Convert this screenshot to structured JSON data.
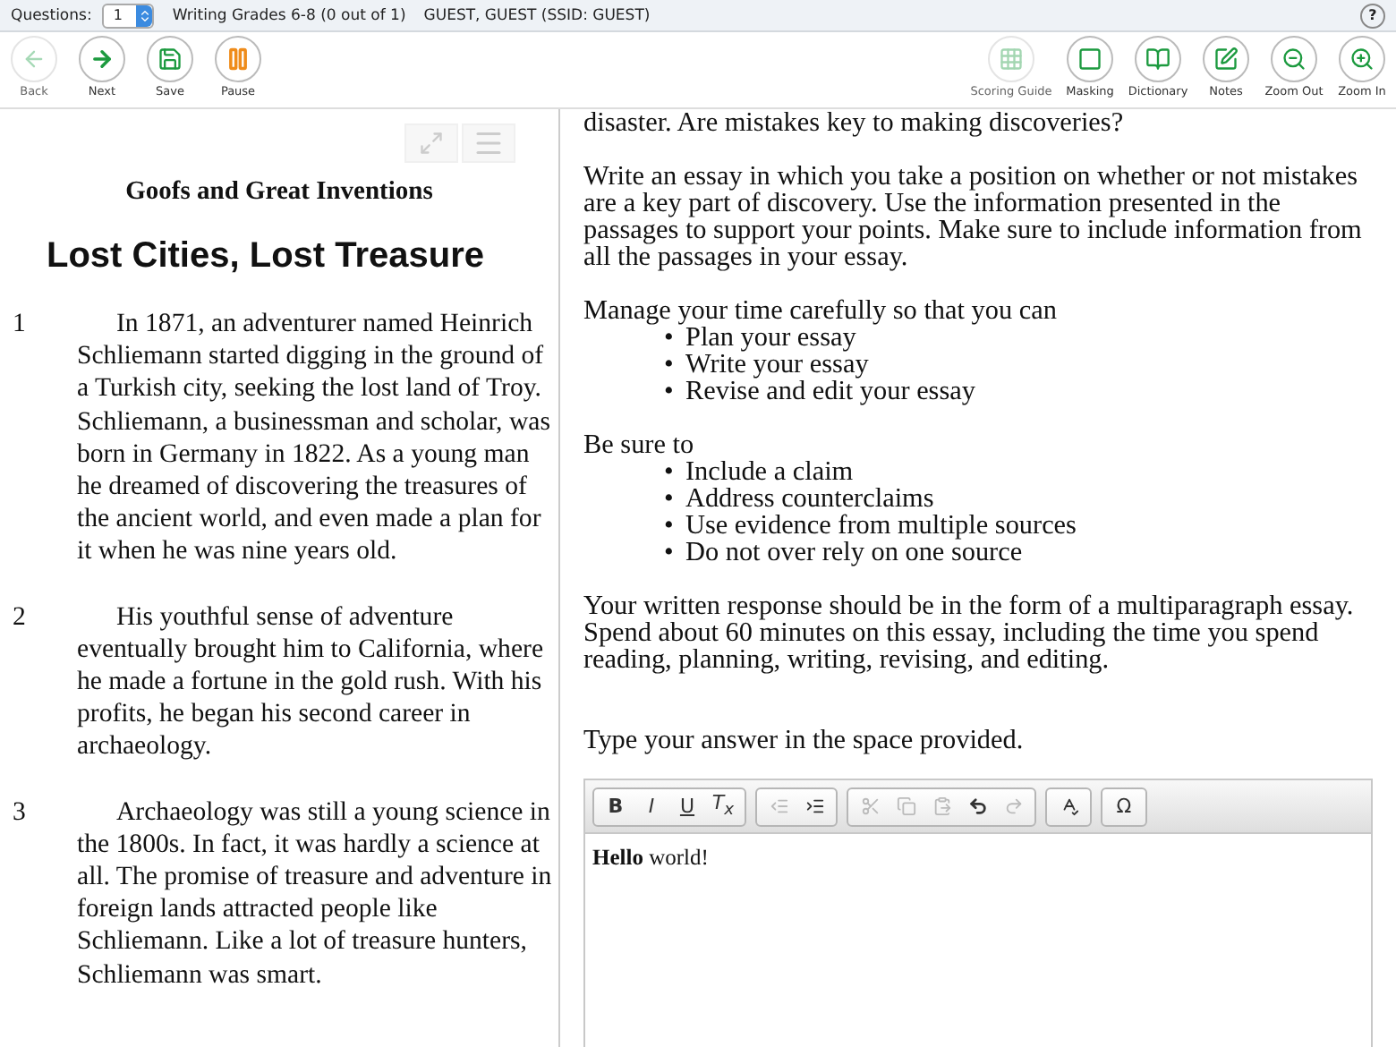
{
  "top_bar": {
    "questions_label": "Questions:",
    "question_value": "1",
    "test_title": "Writing Grades 6-8 (0 out of 1)",
    "student": "GUEST, GUEST (SSID: GUEST)",
    "help": "?"
  },
  "nav_buttons": [
    {
      "kind": "back",
      "label": "Back",
      "disabled": true
    },
    {
      "kind": "next",
      "label": "Next",
      "disabled": false
    },
    {
      "kind": "save",
      "label": "Save",
      "disabled": false
    },
    {
      "kind": "pause",
      "label": "Pause",
      "disabled": false
    }
  ],
  "tool_buttons": [
    {
      "kind": "scoring",
      "label": "Scoring Guide",
      "disabled": true
    },
    {
      "kind": "masking",
      "label": "Masking",
      "disabled": false
    },
    {
      "kind": "dictionary",
      "label": "Dictionary",
      "disabled": false
    },
    {
      "kind": "notes",
      "label": "Notes",
      "disabled": false
    },
    {
      "kind": "zoom_out",
      "label": "Zoom Out",
      "disabled": false
    },
    {
      "kind": "zoom_in",
      "label": "Zoom In",
      "disabled": false
    }
  ],
  "passage": {
    "subtitle": "Goofs and Great Inventions",
    "title": "Lost Cities, Lost Treasure",
    "paragraphs": [
      {
        "number": "1",
        "text": "In 1871, an adventurer named Heinrich Schliemann started digging in the ground of a Turkish city, seeking the lost land of Troy. Schliemann, a businessman and scholar, was born in Germany in 1822. As a young man he dreamed of discovering the treasures of the ancient world, and even made a plan for it when he was nine years old."
      },
      {
        "number": "2",
        "text": "His youthful sense of adventure eventually brought him to California, where he made a fortune in the gold rush. With his profits, he began his second career in archaeology."
      },
      {
        "number": "3",
        "text": "Archaeology was still a young science in the 1800s. In fact, it was hardly a science at all. The promise of treasure and adventure in foreign lands attracted people like Schliemann. Like a lot of treasure hunters, Schliemann was smart."
      }
    ]
  },
  "prompt": {
    "top_line": "disaster. Are mistakes key to making discoveries?",
    "task": "Write an essay in which you take a position on whether or not mistakes are a key part of discovery. Use the information presented in the passages to support your points. Make sure to include information from all the passages in your essay.",
    "bullet": "•",
    "time_intro": "Manage your time carefully so that you can",
    "time_items": [
      "Plan your essay",
      "Write your essay",
      "Revise and edit your essay"
    ],
    "sure_intro": "Be sure to",
    "sure_items": [
      "Include a claim",
      "Address counterclaims",
      "Use evidence from multiple sources",
      "Do not over rely on one source"
    ],
    "response_note": "Your written response should be in the form of a multiparagraph essay. Spend about 60 minutes on this essay, including the time you spend reading, planning, writing, revising, and editing.",
    "answer_instruction": "Type your answer in the space provided."
  },
  "editor": {
    "groups": [
      [
        {
          "kind": "bold",
          "label": "B",
          "disabled": false
        },
        {
          "kind": "italic",
          "label": "I",
          "disabled": false
        },
        {
          "kind": "underline",
          "label": "U",
          "disabled": false
        },
        {
          "kind": "clear_format",
          "label": "T$_{x}$",
          "disabled": false
        }
      ],
      [
        {
          "kind": "outdent",
          "disabled": true
        },
        {
          "kind": "indent",
          "disabled": false
        }
      ],
      [
        {
          "kind": "cut",
          "disabled": true
        },
        {
          "kind": "copy",
          "disabled": true
        },
        {
          "kind": "paste",
          "disabled": true
        },
        {
          "kind": "undo",
          "disabled": false
        },
        {
          "kind": "redo",
          "disabled": true
        }
      ],
      [
        {
          "kind": "spellcheck",
          "disabled": false
        }
      ],
      [
        {
          "kind": "special_char",
          "label": "Ω",
          "disabled": false
        }
      ]
    ],
    "content": "**Hello** world!"
  }
}
